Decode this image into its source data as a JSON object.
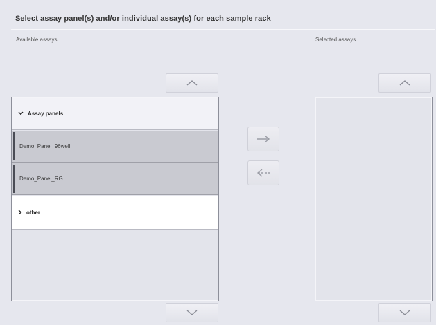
{
  "title": "Select assay panel(s) and/or individual assay(s) for each sample rack",
  "available": {
    "label": "Available assays",
    "group_header": "Assay panels",
    "items": [
      {
        "label": "Demo_Panel_96well"
      },
      {
        "label": "Demo_Panel_RG"
      }
    ],
    "other_label": "other"
  },
  "selected": {
    "label": "Selected assays"
  },
  "icons": {
    "scroll_up": "chevron-up-icon",
    "scroll_down": "chevron-down-icon",
    "move_right": "arrow-right-icon",
    "move_left": "arrow-left-icon",
    "expanded": "chevron-down-icon",
    "collapsed": "chevron-right-icon"
  },
  "colors": {
    "background": "#e6e7ee",
    "selected_row": "#c9cad1",
    "header_row": "#f2f2f7",
    "row_marker": "#4a4c55"
  }
}
